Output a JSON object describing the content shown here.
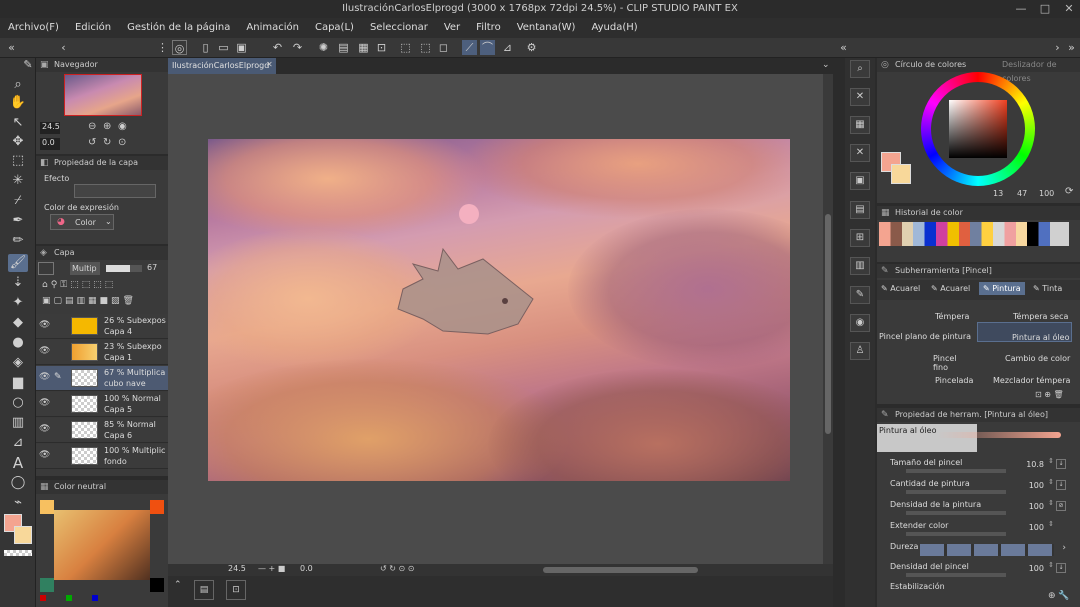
{
  "window": {
    "title": "IlustraciónCarlosElprogd (3000 x 1768px 72dpi 24.5%) - CLIP STUDIO PAINT EX"
  },
  "menu": [
    "Archivo(F)",
    "Edición",
    "Gestión de la página",
    "Animación",
    "Capa(L)",
    "Seleccionar",
    "Ver",
    "Filtro",
    "Ventana(W)",
    "Ayuda(H)"
  ],
  "navigator": {
    "title": "Navegador",
    "zoom": "24.5",
    "rotation": "0.0"
  },
  "layer_property": {
    "title": "Propiedad de la capa",
    "effect_label": "Efecto",
    "expression_label": "Color de expresión",
    "expression_value": "Color"
  },
  "layers": {
    "title": "Capa",
    "blend_mode": "Multip",
    "opacity": "67",
    "items": [
      {
        "blend": "26 % Subexpos",
        "name": "Capa 4"
      },
      {
        "blend": "23 % Subexpo",
        "name": "Capa 1"
      },
      {
        "blend": "67 % Multiplica",
        "name": "cubo nave"
      },
      {
        "blend": "100 % Normal",
        "name": "Capa 5"
      },
      {
        "blend": "85 % Normal",
        "name": "Capa 6"
      },
      {
        "blend": "100 % Multiplic",
        "name": "fondo"
      }
    ]
  },
  "neutral_color": {
    "title": "Color neutral"
  },
  "document_tab": "IlustraciónCarlosElprogd",
  "canvas_status": {
    "zoom": "24.5",
    "angle": "0.0"
  },
  "color_wheel": {
    "title": "Círculo de colores",
    "tab2": "Deslizador de colores",
    "h": "13",
    "s": "47",
    "v": "100"
  },
  "color_history": {
    "title": "Historial de color"
  },
  "subtool": {
    "title": "Subherramienta [Pincel]",
    "tabs": [
      "Acuarel",
      "Acuarel",
      "Pintura",
      "Tinta"
    ],
    "brushes": [
      "Témpera",
      "Témpera seca",
      "Pincel plano de pintura",
      "Pintura al óleo",
      "Pincel fino",
      "Cambio de color",
      "Pincelada",
      "Mezclador témpera"
    ]
  },
  "tool_property": {
    "title": "Propiedad de herram. [Pintura al óleo]",
    "brush_name": "Pintura al óleo",
    "props": [
      {
        "label": "Tamaño del pincel",
        "value": "10.8"
      },
      {
        "label": "Cantidad de pintura",
        "value": "100"
      },
      {
        "label": "Densidad de la pintura",
        "value": "100"
      },
      {
        "label": "Extender color",
        "value": "100"
      },
      {
        "label": "Dureza",
        "value": ""
      },
      {
        "label": "Densidad del pincel",
        "value": "100"
      },
      {
        "label": "Estabilización",
        "value": ""
      }
    ]
  },
  "colors": {
    "main": "#f4a490",
    "sub": "#f8d89a",
    "accent": "#4a5a74"
  }
}
